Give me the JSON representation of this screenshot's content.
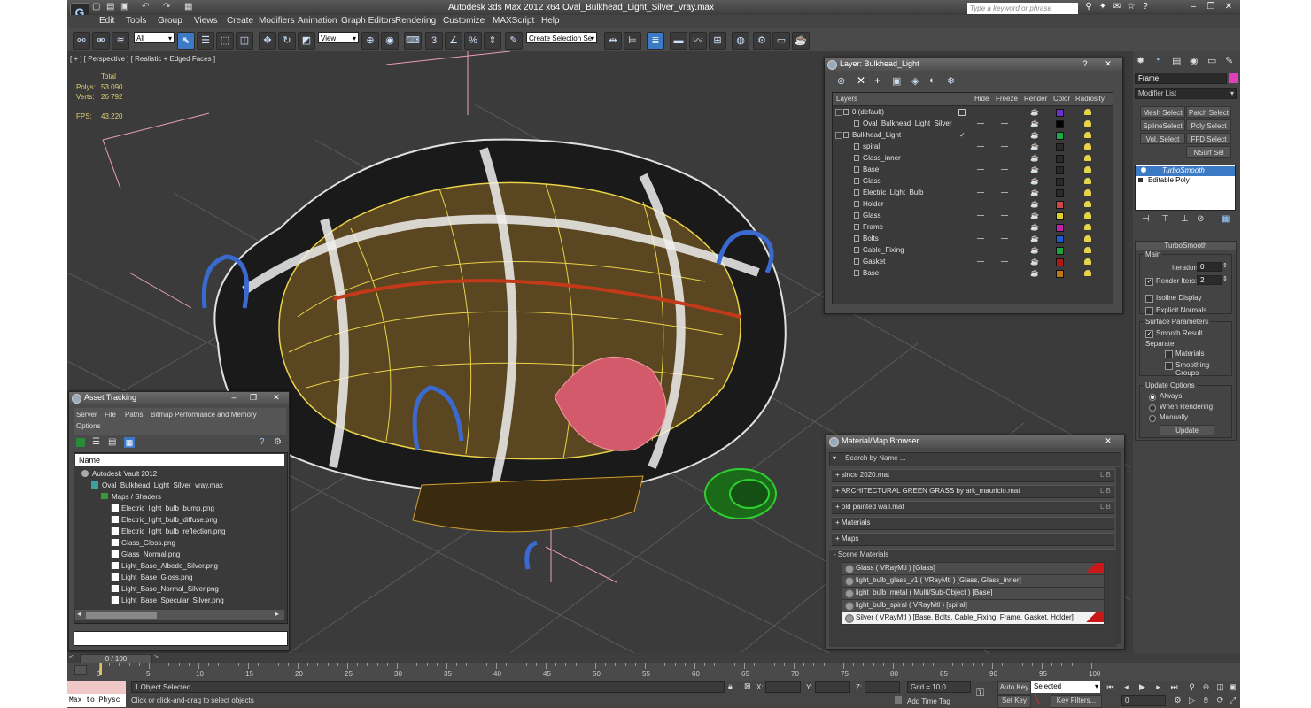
{
  "window": {
    "title": "Autodesk 3ds Max  2012 x64      Oval_Bulkhead_Light_Silver_vray.max",
    "help_search_placeholder": "Type a keyword or phrase"
  },
  "menu": [
    "Edit",
    "Tools",
    "Group",
    "Views",
    "Create",
    "Modifiers",
    "Animation",
    "Graph Editors",
    "Rendering",
    "Customize",
    "MAXScript",
    "Help"
  ],
  "toolbar": {
    "selection_filter": "All",
    "reference_coord": "View",
    "named_selection": "Create Selection Se"
  },
  "viewport": {
    "label": "[ + ] [ Perspective ] [ Realistic + Edged Faces ]",
    "stats": {
      "total_label": "Total",
      "polys_label": "Polys:",
      "polys_value": "53 090",
      "verts_label": "Verts:",
      "verts_value": "26 792",
      "fps_label": "FPS:",
      "fps_value": "43,220"
    }
  },
  "layer_window": {
    "title": "Layer: Bulkhead_Light",
    "columns": [
      "Layers",
      "Hide",
      "Freeze",
      "Render",
      "Color",
      "Radiosity"
    ],
    "rows": [
      {
        "name": "0 (default)",
        "indent": 0,
        "color": "#6a2fd0",
        "is_layer": true,
        "active": true,
        "current": false
      },
      {
        "name": "Oval_Bulkhead_Light_Silver",
        "indent": 1,
        "color": "#000000",
        "is_layer": false,
        "active": false,
        "current": false
      },
      {
        "name": "Bulkhead_Light",
        "indent": 0,
        "color": "#1faa4a",
        "is_layer": true,
        "active": false,
        "current": true
      },
      {
        "name": "spiral",
        "indent": 1,
        "color": "#2a2a2a",
        "is_layer": false,
        "active": false,
        "current": false
      },
      {
        "name": "Glass_inner",
        "indent": 1,
        "color": "#2a2a2a",
        "is_layer": false,
        "active": false,
        "current": false
      },
      {
        "name": "Base",
        "indent": 1,
        "color": "#2a2a2a",
        "is_layer": false,
        "active": false,
        "current": false
      },
      {
        "name": "Glass",
        "indent": 1,
        "color": "#2a2a2a",
        "is_layer": false,
        "active": false,
        "current": false
      },
      {
        "name": "Electric_Light_Bulb",
        "indent": 1,
        "color": "#2a2a2a",
        "is_layer": false,
        "active": false,
        "current": false
      },
      {
        "name": "Holder",
        "indent": 1,
        "color": "#d04848",
        "is_layer": false,
        "active": false,
        "current": false
      },
      {
        "name": "Glass",
        "indent": 1,
        "color": "#e0d020",
        "is_layer": false,
        "active": false,
        "current": false
      },
      {
        "name": "Frame",
        "indent": 1,
        "color": "#c020b0",
        "is_layer": false,
        "active": false,
        "current": false
      },
      {
        "name": "Bolts",
        "indent": 1,
        "color": "#1e5ad8",
        "is_layer": false,
        "active": false,
        "current": false
      },
      {
        "name": "Cable_Fixing",
        "indent": 1,
        "color": "#1aa43a",
        "is_layer": false,
        "active": false,
        "current": false
      },
      {
        "name": "Gasket",
        "indent": 1,
        "color": "#b01818",
        "is_layer": false,
        "active": false,
        "current": false
      },
      {
        "name": "Base",
        "indent": 1,
        "color": "#c07818",
        "is_layer": false,
        "active": false,
        "current": false
      }
    ]
  },
  "asset_window": {
    "title": "Asset Tracking",
    "menu": [
      "Server",
      "File",
      "Paths",
      "Bitmap Performance and Memory",
      "Options"
    ],
    "column": "Name",
    "items": [
      {
        "name": "Autodesk Vault 2012",
        "level": 0,
        "type": "vault"
      },
      {
        "name": "Oval_Bulkhead_Light_Silver_vray.max",
        "level": 1,
        "type": "max"
      },
      {
        "name": "Maps / Shaders",
        "level": 2,
        "type": "folder"
      },
      {
        "name": "Electric_light_bulb_bump.png",
        "level": 3,
        "type": "file"
      },
      {
        "name": "Electric_light_bulb_diffuse.png",
        "level": 3,
        "type": "file"
      },
      {
        "name": "Electric_light_bulb_reflection.png",
        "level": 3,
        "type": "file"
      },
      {
        "name": "Glass_Gloss.png",
        "level": 3,
        "type": "file"
      },
      {
        "name": "Glass_Normal.png",
        "level": 3,
        "type": "file"
      },
      {
        "name": "Light_Base_Albedo_Silver.png",
        "level": 3,
        "type": "file"
      },
      {
        "name": "Light_Base_Gloss.png",
        "level": 3,
        "type": "file"
      },
      {
        "name": "Light_Base_Normal_Silver.png",
        "level": 3,
        "type": "file"
      },
      {
        "name": "Light_Base_Specular_Silver.png",
        "level": 3,
        "type": "file"
      }
    ]
  },
  "material_browser": {
    "title": "Material/Map Browser",
    "search_placeholder": "Search by Name ...",
    "groups": [
      {
        "label": "+ since 2020.mat",
        "tag": "LIB"
      },
      {
        "label": "+ ARCHITECTURAL GREEN GRASS by ark_mauricio.mat",
        "tag": "LIB"
      },
      {
        "label": "+ old painted wall.mat",
        "tag": "LIB"
      },
      {
        "label": "+ Materials",
        "tag": ""
      },
      {
        "label": "+ Maps",
        "tag": ""
      }
    ],
    "scene_header": "- Scene Materials",
    "scene_materials": [
      {
        "label": "Glass  ( VRayMtl ) [Glass]",
        "flag": true,
        "selected": false
      },
      {
        "label": "light_bulb_glass_v1  ( VRayMtl ) [Glass, Glass_inner]",
        "flag": false,
        "selected": false
      },
      {
        "label": "light_bulb_metal  ( Multi/Sub-Object ) [Base]",
        "flag": false,
        "selected": false
      },
      {
        "label": "light_bulb_spiral  ( VRayMtl ) [spiral]",
        "flag": false,
        "selected": false
      },
      {
        "label": "Silver  ( VRayMtl ) [Base, Bolts, Cable_Fixing, Frame, Gasket, Holder]",
        "flag": true,
        "selected": true
      }
    ]
  },
  "command_panel": {
    "object_name": "Frame",
    "object_color": "#e040c0",
    "modifier_list": "Modifier List",
    "buttons": [
      "Mesh Select",
      "Patch Select",
      "SplineSelect",
      "Poly Select",
      "Vol. Select",
      "FFD Select",
      "NSurf Sel"
    ],
    "stack": [
      {
        "label": "TurboSmooth",
        "selected": true
      },
      {
        "label": "Editable Poly",
        "selected": false
      }
    ],
    "turbosmooth": {
      "title": "TurboSmooth",
      "main": "Main",
      "iterations_label": "Iterations:",
      "iterations_value": "0",
      "render_iters_label": "Render Iters:",
      "render_iters_value": "2",
      "render_iters_checked": true,
      "isoline_label": "Isoline Display",
      "explicit_label": "Explicit Normals",
      "surface_label": "Surface Parameters",
      "smooth_result_label": "Smooth Result",
      "separate_label": "Separate",
      "materials_label": "Materials",
      "smoothing_groups_label": "Smoothing Groups",
      "update_options_label": "Update Options",
      "always_label": "Always",
      "when_rendering_label": "When Rendering",
      "manually_label": "Manually",
      "update_button": "Update"
    }
  },
  "timeline": {
    "frame_display": "0 / 100",
    "ticks": [
      "0",
      "5",
      "10",
      "15",
      "20",
      "25",
      "30",
      "35",
      "40",
      "45",
      "50",
      "55",
      "60",
      "65",
      "70",
      "75",
      "80",
      "85",
      "90",
      "95",
      "100"
    ]
  },
  "status": {
    "maxscript_label": "Max to Physc",
    "selection_text": "1 Object Selected",
    "prompt_text": "Click or click-and-drag to select objects",
    "x_label": "X:",
    "y_label": "Y:",
    "z_label": "Z:",
    "grid_text": "Grid = 10,0",
    "add_time_tag": "Add Time Tag",
    "auto_key": "Auto Key",
    "set_key": "Set Key",
    "selected_option": "Selected",
    "key_filters": "Key Filters...",
    "current_frame": "0"
  }
}
